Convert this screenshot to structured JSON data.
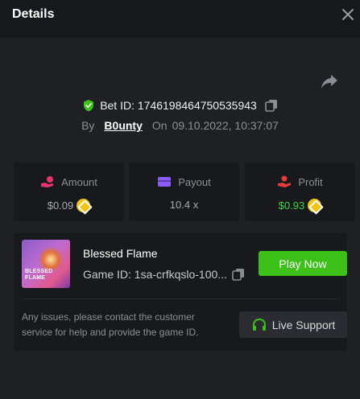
{
  "header": {
    "title": "Details"
  },
  "bet": {
    "id_label": "Bet ID: 1746198464750535943",
    "by": "By",
    "user": "B0unty",
    "on": "On",
    "datetime": "09.10.2022, 10:37:07"
  },
  "stats": [
    {
      "label": "Amount",
      "value": "$0.09",
      "icon": "coins-hand-icon",
      "color": "#e8336f"
    },
    {
      "label": "Payout",
      "value": "10.4 x",
      "icon": "wallet-icon",
      "color": "#8a5cf6"
    },
    {
      "label": "Profit",
      "value": "$0.93",
      "icon": "profit-hand-icon",
      "color": "#e83a3a"
    }
  ],
  "game": {
    "name": "Blessed Flame",
    "thumb_text": "BLESSED FLAME",
    "id_label": "Game ID: 1sa-crfkqslo-100...",
    "play_label": "Play Now",
    "issues_text": "Any issues, please contact the customer service for help and provide the game ID.",
    "support_label": "Live Support"
  },
  "colors": {
    "accent_green": "#3bc117",
    "profit_green": "#3fd44b",
    "coin": "#f1c40f"
  }
}
